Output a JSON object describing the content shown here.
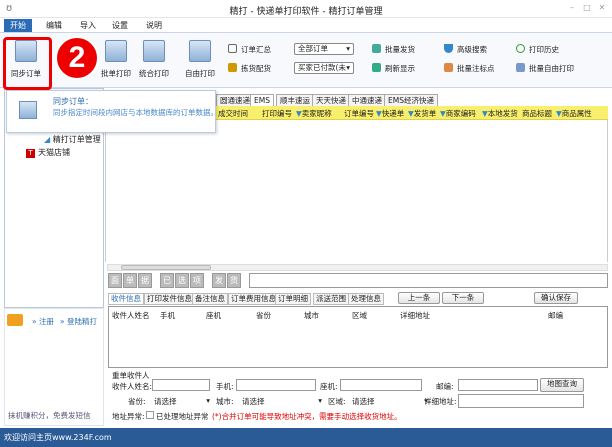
{
  "window": {
    "title": "精打 - 快递单打印软件 - 精打订单管理"
  },
  "menu": [
    "开始",
    "编辑",
    "导入",
    "设置",
    "说明"
  ],
  "ribbon": {
    "big_buttons": [
      "同步订单",
      "底单打印",
      "批单打印",
      "统合打印",
      "自由打印"
    ],
    "small_buttons": [
      "订单汇总",
      "拣货配货",
      "批量发货",
      "刷新显示",
      "高级搜索",
      "批量注标点",
      "打印历史",
      "批量自由打印"
    ],
    "order_filter": "全部订单",
    "payment_filter": "买家已付款(未"
  },
  "step_badge": "2",
  "tooltip": {
    "title": "同步订单：",
    "text": "同步指定时间段内网店与本地数据库的订单数据。"
  },
  "tree": [
    "精打订单管理",
    "天猫店铺"
  ],
  "carrier_tabs": [
    "圆通速递",
    "EMS",
    "顺丰速运",
    "天天快递",
    "中通速递",
    "EMS经济快递"
  ],
  "grid_columns": [
    "成交时间",
    "打印编号",
    "卖家昵称",
    "订单编号",
    "快递单",
    "发货单",
    "商家编码",
    "本地发货",
    "商品标题",
    "商品属性"
  ],
  "grid_buttons": [
    "面",
    "单",
    "据",
    "已",
    "选",
    "项",
    "发",
    "货"
  ],
  "detail_tabs": [
    "收件信息",
    "打印发件信息",
    "备注信息",
    "订单费用信息",
    "订单明细",
    "派送范围",
    "处理信息"
  ],
  "nav": {
    "prev": "上一条",
    "next": "下一条",
    "save": "确认保存"
  },
  "detail_columns": [
    "收件人姓名",
    "手机",
    "座机",
    "省份",
    "城市",
    "区域",
    "详细地址",
    "邮编"
  ],
  "form": {
    "section": "重单收件人",
    "name": "收件人姓名:",
    "mobile": "手机:",
    "phone": "座机:",
    "zip": "邮编:",
    "map": "地图查询",
    "province": "省份:",
    "city": "城市:",
    "district": "区域:",
    "address": "详细地址:",
    "placeholder": "请选择",
    "abnormal": "地址异常:",
    "handled": "已处理地址异常",
    "warning": "(*)合并订单可能导致地址冲突，需要手动选择收货地址。"
  },
  "left": {
    "register": "» 注册",
    "login": "» 登陆精打",
    "promo": "抹机赚积分，免费发短信"
  },
  "status": "欢迎访问主页www.234F.com",
  "colors": {
    "accent": "#2b6cb4",
    "header": "#f8ef6d",
    "warning": "#e00000"
  }
}
